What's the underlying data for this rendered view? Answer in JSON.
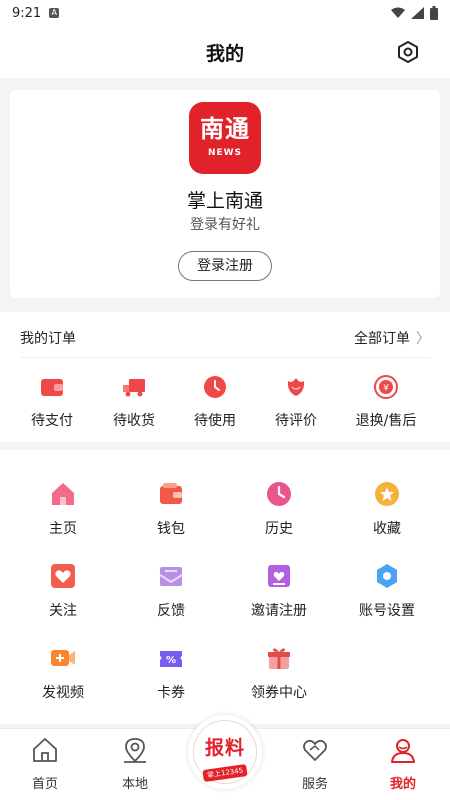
{
  "status": {
    "time": "9:21",
    "sim_badge": "A"
  },
  "header": {
    "title": "我的"
  },
  "profile": {
    "logo_cn": "南通",
    "logo_en": "NEWS",
    "app_name": "掌上南通",
    "subtitle": "登录有好礼",
    "login_label": "登录注册"
  },
  "orders": {
    "title": "我的订单",
    "all_label": "全部订单",
    "items": [
      {
        "label": "待支付",
        "icon": "wallet-icon",
        "color": "#f04848"
      },
      {
        "label": "待收货",
        "icon": "truck-icon",
        "color": "#f04848"
      },
      {
        "label": "待使用",
        "icon": "clock-icon",
        "color": "#f04848"
      },
      {
        "label": "待评价",
        "icon": "rose-icon",
        "color": "#f04848"
      },
      {
        "label": "退换/售后",
        "icon": "refund-icon",
        "color": "#f04848"
      }
    ]
  },
  "services": [
    {
      "label": "主页",
      "icon": "home-icon",
      "color": "#f26b8a"
    },
    {
      "label": "钱包",
      "icon": "wallet-icon",
      "color": "#f05a45"
    },
    {
      "label": "历史",
      "icon": "clock-icon",
      "color": "#e9558d"
    },
    {
      "label": "收藏",
      "icon": "star-icon",
      "color": "#f6b13a"
    },
    {
      "label": "关注",
      "icon": "heart-icon",
      "color": "#f45d4e"
    },
    {
      "label": "反馈",
      "icon": "mail-icon",
      "color": "#b590e5"
    },
    {
      "label": "邀请注册",
      "icon": "invite-icon",
      "color": "#b45fe0"
    },
    {
      "label": "账号设置",
      "icon": "settings-icon",
      "color": "#4aa3f0"
    },
    {
      "label": "发视频",
      "icon": "video-icon",
      "color": "#f7862f"
    },
    {
      "label": "卡券",
      "icon": "coupon-icon",
      "color": "#7a5cf0"
    },
    {
      "label": "领券中心",
      "icon": "gift-icon",
      "color": "#e24b4b"
    }
  ],
  "tabs": [
    {
      "label": "首页",
      "icon": "home-outline-icon"
    },
    {
      "label": "本地",
      "icon": "location-icon"
    },
    {
      "label": "服务",
      "icon": "heart-outline-icon"
    },
    {
      "label": "我的",
      "icon": "user-icon"
    }
  ],
  "report": {
    "title": "报料",
    "hotline": "掌上12345"
  },
  "accent": "#e2222a"
}
